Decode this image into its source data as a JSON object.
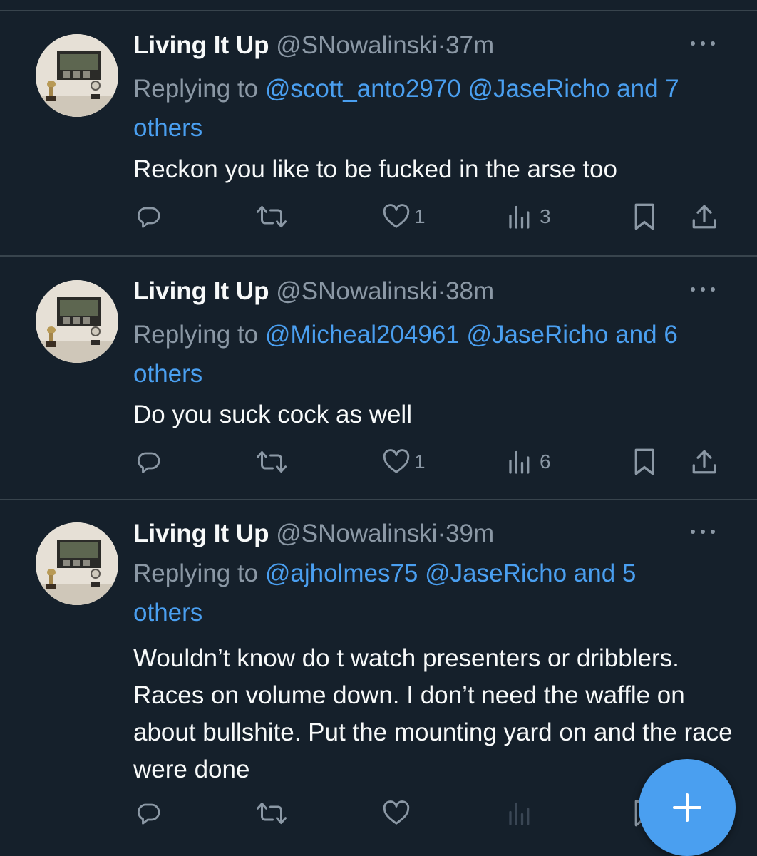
{
  "theme": {
    "background": "#15202b",
    "accent": "#4a9ff0",
    "muted": "#8b98a5",
    "text": "#f7f9f9"
  },
  "tweets": [
    {
      "name": "Living It Up",
      "handle": "@SNowalinski",
      "separator": "·",
      "time": "37m",
      "replying_prefix": "Replying to",
      "replying_mentions": [
        "@scott_anto2970",
        "@JaseRicho"
      ],
      "replying_suffix": "and 7 others",
      "text": "Reckon you like to be fucked in the arse too",
      "likes": "1",
      "views": "3"
    },
    {
      "name": "Living It Up",
      "handle": "@SNowalinski",
      "separator": "·",
      "time": "38m",
      "replying_prefix": "Replying to",
      "replying_mentions": [
        "@Micheal204961",
        "@JaseRicho"
      ],
      "replying_suffix": "and 6 others",
      "text": "Do you suck cock as well",
      "likes": "1",
      "views": "6"
    },
    {
      "name": "Living It Up",
      "handle": "@SNowalinski",
      "separator": "·",
      "time": "39m",
      "replying_prefix": "Replying to",
      "replying_mentions": [
        "@ajholmes75",
        "@JaseRicho"
      ],
      "replying_suffix": "and 5 others",
      "text": "Wouldn’t know do t watch presenters or dribblers. Races on volume down. I don’t need the waffle on about bullshite. Put the mounting yard on and the race  were done",
      "likes": "",
      "views": ""
    }
  ],
  "icons": {
    "reply": "reply-icon",
    "retweet": "retweet-icon",
    "like": "heart-icon",
    "views": "views-icon",
    "bookmark": "bookmark-icon",
    "share": "share-icon",
    "more": "more-icon",
    "compose": "plus-icon"
  }
}
